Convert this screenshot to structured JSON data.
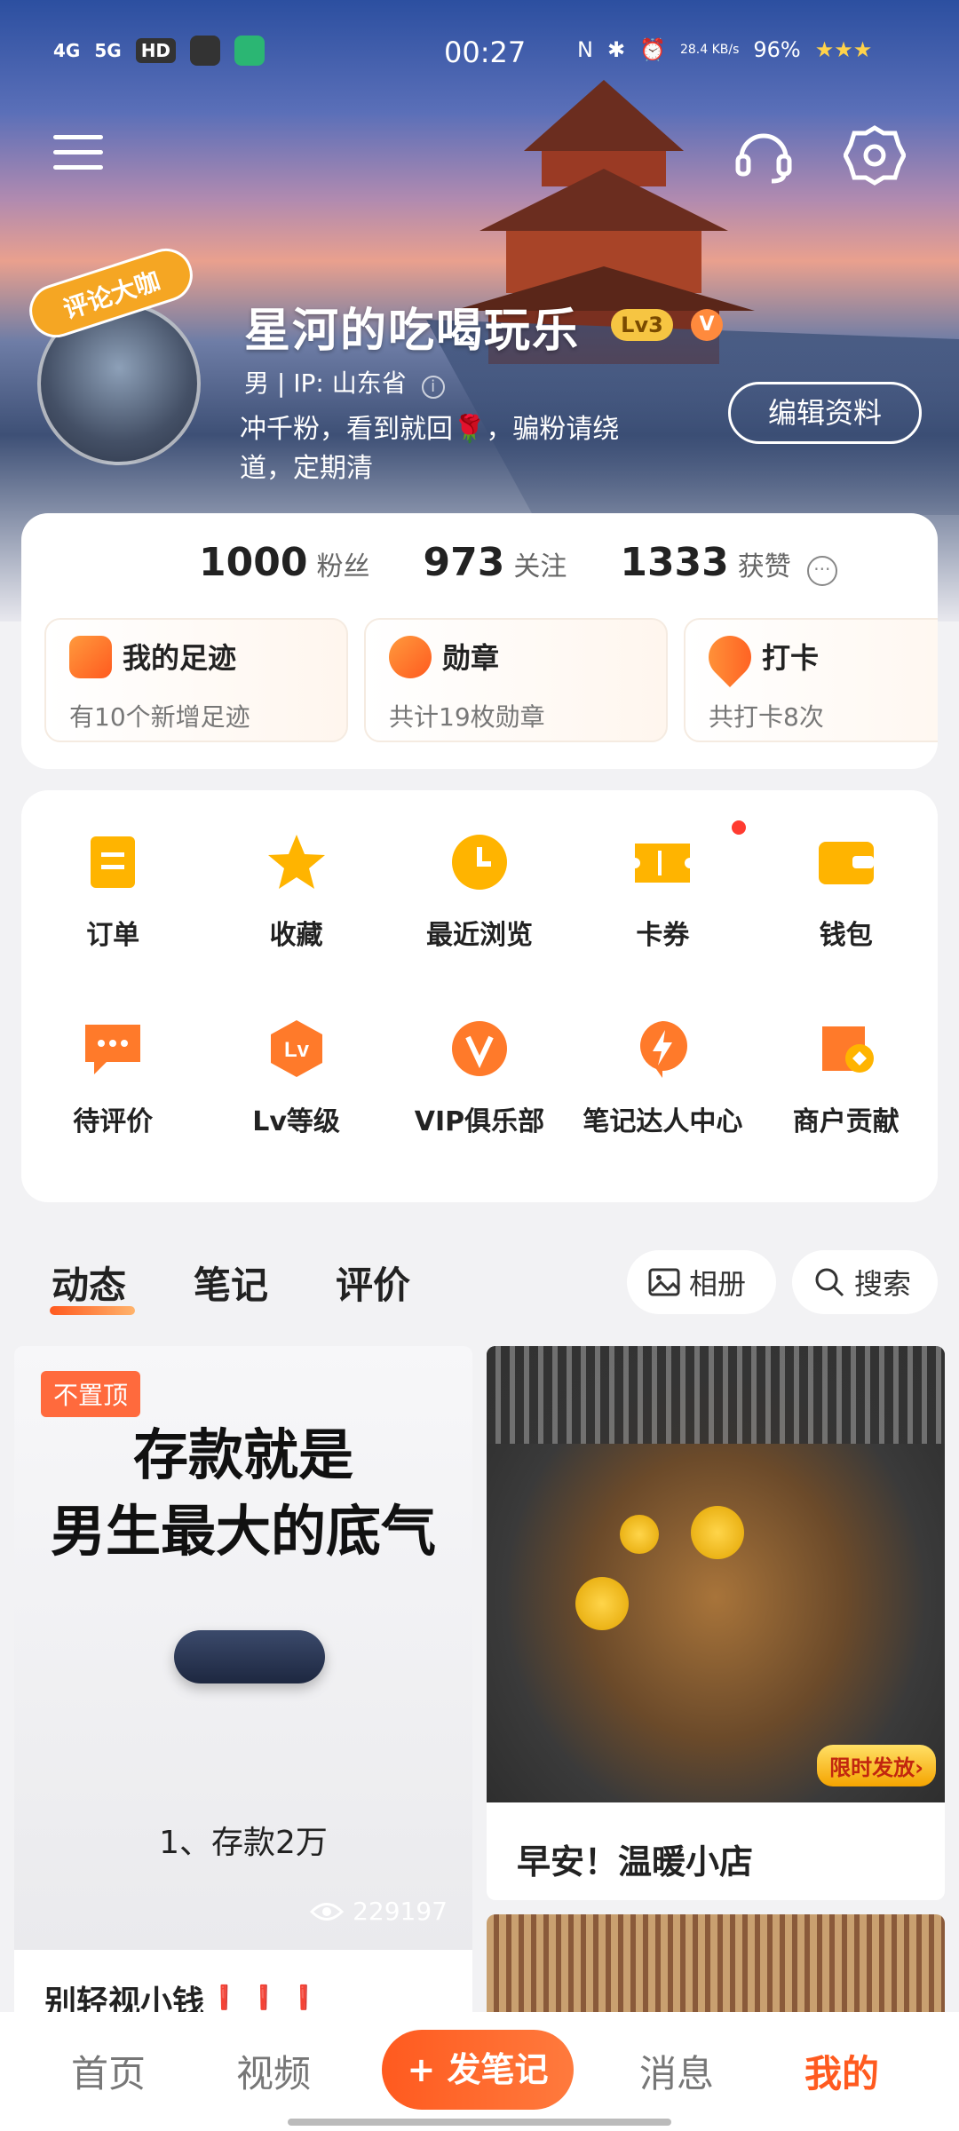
{
  "status_bar": {
    "network_left": "4G",
    "network_right": "5G",
    "hd": "HD",
    "time": "00:27",
    "speed": "28.4 KB/s",
    "battery": "96%"
  },
  "profile": {
    "badge": "评论大咖",
    "nickname": "星河的吃喝玩乐",
    "level": "Lv3",
    "vip": "V",
    "sub_info": "男 | IP: 山东省",
    "bio": "冲千粉，看到就回🌹，骗粉请绕道，定期清",
    "edit_button": "编辑资料"
  },
  "stats": {
    "fans_num": "1000",
    "fans_label": "粉丝",
    "follow_num": "973",
    "follow_label": "关注",
    "likes_num": "1333",
    "likes_label": "获赞",
    "more": "···"
  },
  "features": [
    {
      "title": "我的足迹",
      "sub": "有10个新增足迹"
    },
    {
      "title": "勋章",
      "sub": "共计19枚勋章"
    },
    {
      "title": "打卡",
      "sub": "共打卡8次"
    }
  ],
  "grid": [
    {
      "label": "订单",
      "icon": "order-icon"
    },
    {
      "label": "收藏",
      "icon": "star-icon"
    },
    {
      "label": "最近浏览",
      "icon": "clock-icon"
    },
    {
      "label": "卡券",
      "icon": "ticket-icon"
    },
    {
      "label": "钱包",
      "icon": "wallet-icon"
    },
    {
      "label": "待评价",
      "icon": "comment-icon"
    },
    {
      "label": "Lv等级",
      "icon": "level-icon"
    },
    {
      "label": "VIP俱乐部",
      "icon": "vip-icon"
    },
    {
      "label": "笔记达人中心",
      "icon": "lightning-icon"
    },
    {
      "label": "商户贡献",
      "icon": "shop-icon"
    }
  ],
  "tabs": {
    "dynamic": "动态",
    "notes": "笔记",
    "reviews": "评价",
    "album": "相册",
    "search": "搜索"
  },
  "feed": {
    "left": {
      "pin_tag": "不置顶",
      "poster_line1": "存款就是",
      "poster_line2": "男生最大的底气",
      "poster_sub": "1、存款2万",
      "views": "229197",
      "caption": "别轻视小钱❗❗❗"
    },
    "right": {
      "promo": "限时发放›",
      "caption": "早安！温暖小店"
    }
  },
  "bottom_nav": {
    "home": "首页",
    "video": "视频",
    "post": "+ 发笔记",
    "messages": "消息",
    "me": "我的"
  },
  "colors": {
    "accent": "#ff5a1f",
    "icon_orange": "#ff8a1f",
    "icon_yellow": "#ffb400"
  }
}
